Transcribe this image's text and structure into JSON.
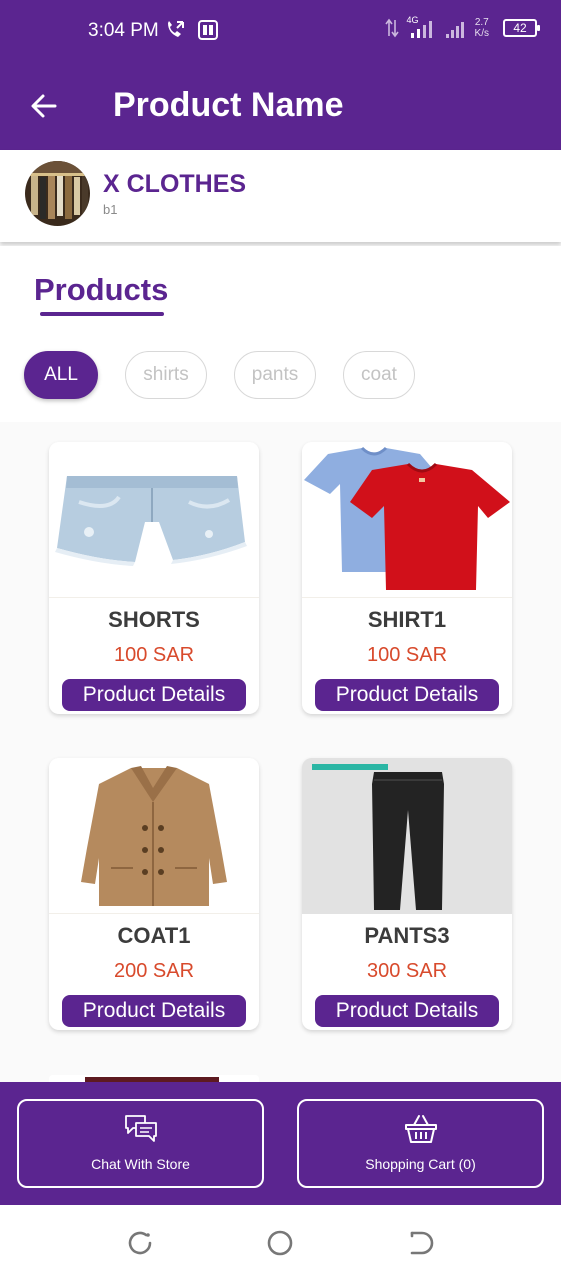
{
  "status_bar": {
    "time": "3:04 PM",
    "network": "4G",
    "speed_value": "2.7",
    "speed_unit": "K/s",
    "battery": "42"
  },
  "app_bar": {
    "title": "Product Name"
  },
  "store": {
    "name": "X CLOTHES",
    "subtitle": "b1"
  },
  "products_section": {
    "title": "Products",
    "filters": [
      {
        "label": "ALL",
        "selected": true
      },
      {
        "label": "shirts",
        "selected": false
      },
      {
        "label": "pants",
        "selected": false
      },
      {
        "label": "coat",
        "selected": false
      }
    ]
  },
  "products": [
    {
      "name": "SHORTS",
      "price": "100 SAR",
      "details_label": "Product Details",
      "image": "denim-shorts"
    },
    {
      "name": "SHIRT1",
      "price": "100 SAR",
      "details_label": "Product Details",
      "image": "t-shirts"
    },
    {
      "name": "COAT1",
      "price": "200 SAR",
      "details_label": "Product Details",
      "image": "tan-coat"
    },
    {
      "name": "PANTS3",
      "price": "300 SAR",
      "details_label": "Product Details",
      "image": "black-pants"
    }
  ],
  "bottom_bar": {
    "chat_label": "Chat With Store",
    "chat_icon": "chat-bubbles-icon",
    "cart_label": "Shopping Cart (0)",
    "cart_icon": "basket-icon"
  },
  "colors": {
    "primary": "#5b2590",
    "price": "#d84a2c",
    "title_text": "#3c3c3c"
  }
}
